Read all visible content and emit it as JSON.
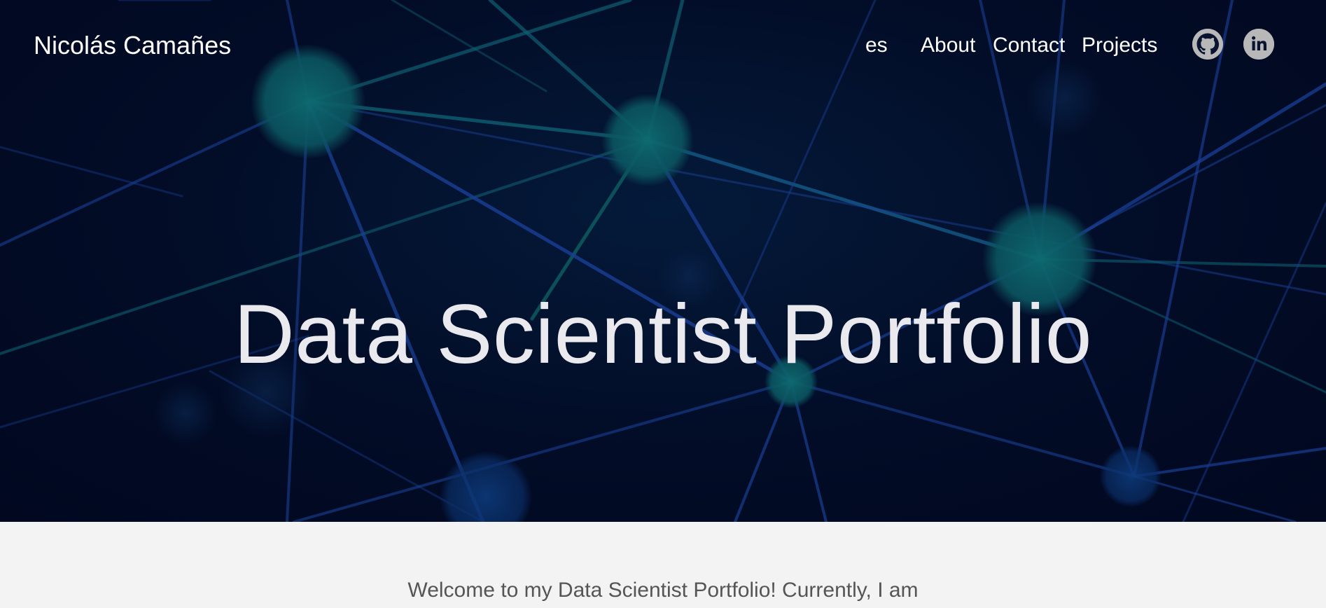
{
  "header": {
    "brand": "Nicolás Camañes",
    "nav": {
      "lang": "es",
      "about": "About",
      "contact": "Contact",
      "projects": "Projects"
    },
    "social": [
      {
        "name": "github-icon"
      },
      {
        "name": "linkedin-icon"
      }
    ]
  },
  "hero": {
    "title": "Data Scientist Portfolio"
  },
  "main": {
    "intro": "Welcome to my Data Scientist Portfolio! Currently, I am"
  },
  "colors": {
    "hero_background": "#020c26",
    "node_teal": "#0d5f66",
    "line_blue": "#1f4a9e",
    "icon_gray": "#b8b8b8",
    "page_background": "#f3f3f3"
  }
}
